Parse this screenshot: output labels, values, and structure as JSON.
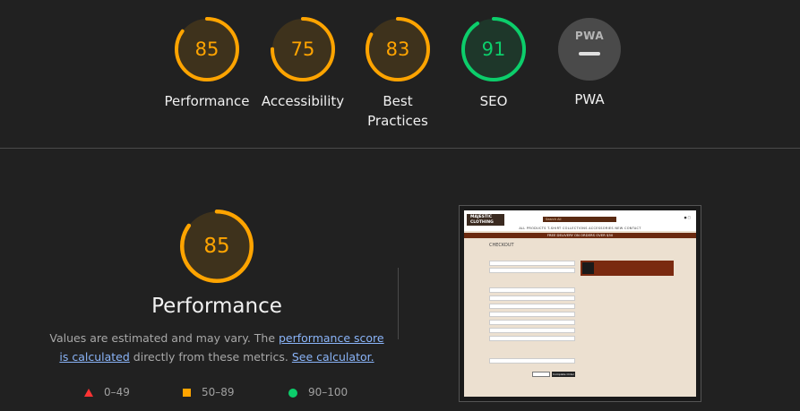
{
  "colors": {
    "pass": "#0cce6b",
    "average": "#ffa400",
    "fail": "#ff3333",
    "link": "#8ab4f8",
    "neutral": "#4a4a4a"
  },
  "categories": [
    {
      "label": "Performance",
      "score": 85,
      "level": "average"
    },
    {
      "label": "Accessibility",
      "score": 75,
      "level": "average"
    },
    {
      "label": "Best\nPractices",
      "label_line1": "Best",
      "label_line2": "Practices",
      "score": 83,
      "level": "average"
    },
    {
      "label": "SEO",
      "score": 91,
      "level": "pass"
    }
  ],
  "pwa": {
    "badge": "PWA",
    "label": "PWA"
  },
  "performance": {
    "score": 85,
    "title": "Performance",
    "desc_prefix": "Values are estimated and may vary. The ",
    "desc_link1": "performance score is calculated",
    "desc_middle": " directly from these metrics. ",
    "desc_link2": "See calculator."
  },
  "legend": {
    "fail": "0–49",
    "average": "50–89",
    "pass": "90–100"
  },
  "screenshot": {
    "logo_line1": "MAJESTIC",
    "logo_line2": "CLOTHING",
    "search_placeholder": "Search All",
    "nav": "ALL PRODUCTS    T-SHIRT    COLLECTIONS    ACCESSORIES    NEW    CONTACT",
    "banner": "FREE DELIVERY ON ORDERS OVER $50",
    "title": "CHECKOUT",
    "button": "Complete Order"
  }
}
